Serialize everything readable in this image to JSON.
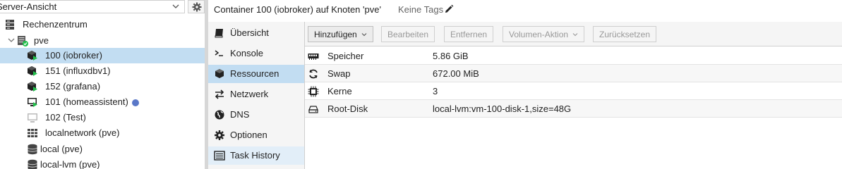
{
  "tree": {
    "view_selector": "Server-Ansicht",
    "items": [
      {
        "label": "Rechenzentrum",
        "icon": "datacenter-icon"
      },
      {
        "label": "pve",
        "icon": "node-online-icon"
      },
      {
        "label": "100 (iobroker)",
        "icon": "container-running-icon"
      },
      {
        "label": "151 (influxdbv1)",
        "icon": "container-running-icon"
      },
      {
        "label": "152 (grafana)",
        "icon": "container-running-icon"
      },
      {
        "label": "101 (homeassistent)",
        "icon": "vm-running-icon"
      },
      {
        "label": "102 (Test)",
        "icon": "vm-stopped-icon"
      },
      {
        "label": "localnetwork (pve)",
        "icon": "network-grid-icon"
      },
      {
        "label": "local (pve)",
        "icon": "storage-icon"
      },
      {
        "label": "local-lvm (pve)",
        "icon": "storage-icon"
      }
    ]
  },
  "header": {
    "title": "Container 100 (iobroker) auf Knoten 'pve'",
    "tags": "Keine Tags"
  },
  "nav": {
    "items": [
      {
        "label": "Übersicht",
        "icon": "book-icon"
      },
      {
        "label": "Konsole",
        "icon": "terminal-icon"
      },
      {
        "label": "Ressourcen",
        "icon": "cube-icon"
      },
      {
        "label": "Netzwerk",
        "icon": "exchange-icon"
      },
      {
        "label": "DNS",
        "icon": "globe-icon"
      },
      {
        "label": "Optionen",
        "icon": "gear-icon"
      },
      {
        "label": "Task History",
        "icon": "list-icon"
      }
    ]
  },
  "toolbar": {
    "add": "Hinzufügen",
    "edit": "Bearbeiten",
    "remove": "Entfernen",
    "volume_action": "Volumen-Aktion",
    "revert": "Zurücksetzen"
  },
  "resources": [
    {
      "key": "Speicher",
      "value": "5.86 GiB",
      "icon": "memory-icon"
    },
    {
      "key": "Swap",
      "value": "672.00 MiB",
      "icon": "refresh-icon"
    },
    {
      "key": "Kerne",
      "value": "3",
      "icon": "cpu-icon"
    },
    {
      "key": "Root-Disk",
      "value": "local-lvm:vm-100-disk-1,size=48G",
      "icon": "hdd-icon"
    }
  ],
  "colors": {
    "selection": "#c2ddf2",
    "running_green": "#21bf4b",
    "status_blue": "#5a78c8"
  }
}
